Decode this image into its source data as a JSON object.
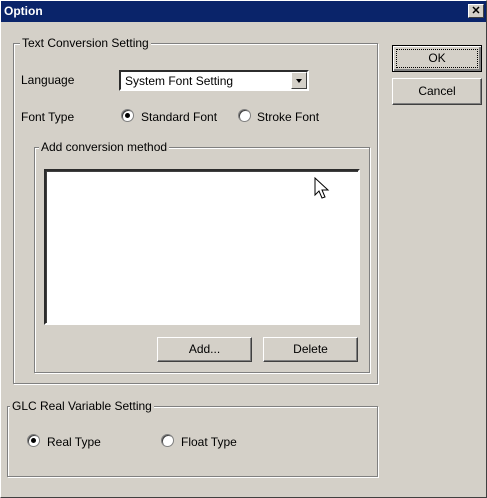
{
  "window": {
    "title": "Option",
    "close_glyph": "✕"
  },
  "text_conversion": {
    "group_label": "Text Conversion Setting",
    "language_label": "Language",
    "language_value": "System Font Setting",
    "font_type_label": "Font Type",
    "font_options": [
      {
        "label": "Standard Font",
        "checked": true
      },
      {
        "label": "Stroke Font",
        "checked": false
      }
    ],
    "add_method": {
      "group_label": "Add conversion method",
      "add_button": "Add...",
      "delete_button": "Delete"
    }
  },
  "glc": {
    "group_label": "GLC Real Variable Setting",
    "options": [
      {
        "label": "Real Type",
        "checked": true
      },
      {
        "label": "Float Type",
        "checked": false
      }
    ]
  },
  "buttons": {
    "ok": "OK",
    "cancel": "Cancel"
  },
  "colors": {
    "titlebar": "#0a246a",
    "face": "#d4d0c8"
  }
}
